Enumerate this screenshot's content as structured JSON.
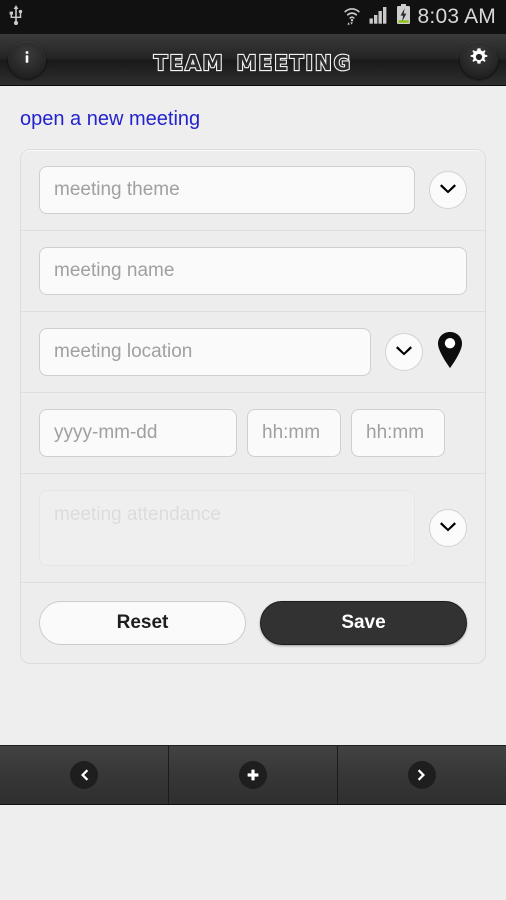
{
  "statusbar": {
    "usb_icon": "usb-icon",
    "wifi_icon": "wifi-icon",
    "signal_icon": "signal-bars-icon",
    "battery_icon": "battery-charging-icon",
    "time": "8:03 AM"
  },
  "titlebar": {
    "title": "Team Meeting",
    "info_icon": "info-icon",
    "settings_icon": "gear-icon"
  },
  "content": {
    "link": "open a new meeting",
    "fields": {
      "theme_placeholder": "meeting theme",
      "name_placeholder": "meeting name",
      "location_placeholder": "meeting location",
      "date_placeholder": "yyyy-mm-dd",
      "time_start_placeholder": "hh:mm",
      "time_end_placeholder": "hh:mm",
      "attendance_placeholder": "meeting attendance",
      "theme_value": "",
      "name_value": "",
      "location_value": "",
      "date_value": "",
      "time_start_value": "",
      "time_end_value": "",
      "attendance_value": ""
    },
    "icons": {
      "theme_dropdown": "chevron-down-icon",
      "location_dropdown": "chevron-down-icon",
      "location_pin": "map-pin-icon",
      "attendance_dropdown": "chevron-down-icon"
    },
    "buttons": {
      "reset": "Reset",
      "save": "Save"
    }
  },
  "navbar": {
    "back_icon": "chevron-left-icon",
    "add_icon": "plus-icon",
    "forward_icon": "chevron-right-icon"
  },
  "colors": {
    "link": "#2323cc",
    "save_button": "#323232",
    "card_background": "#ededed",
    "page_background": "#eeeeee",
    "battery_green": "#8fc31f"
  }
}
